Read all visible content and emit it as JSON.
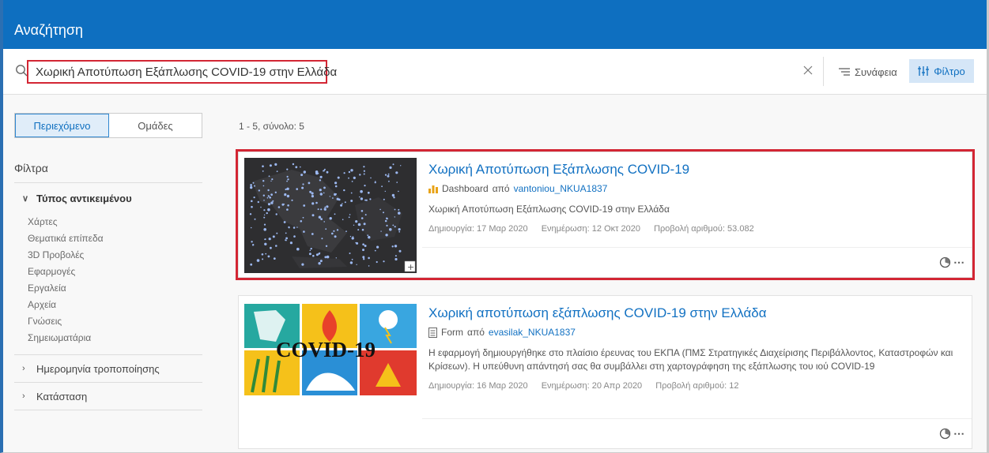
{
  "header": {
    "title": "Αναζήτηση"
  },
  "search": {
    "query": "Χωρική Αποτύπωση Εξάπλωσης COVID-19 στην Ελλάδα"
  },
  "toolbar": {
    "sort_label": "Συνάφεια",
    "filter_label": "Φίλτρο"
  },
  "sidebar": {
    "tabs": [
      "Περιεχόμενο",
      "Ομάδες"
    ],
    "filters_title": "Φίλτρα",
    "item_type": {
      "label": "Τύπος αντικειμένου",
      "options": [
        "Χάρτες",
        "Θεματικά επίπεδα",
        "3D Προβολές",
        "Εφαρμογές",
        "Εργαλεία",
        "Αρχεία",
        "Γνώσεις",
        "Σημειωματάρια"
      ]
    },
    "date_modified_label": "Ημερομηνία τροποποίησης",
    "status_label": "Κατάσταση"
  },
  "results": {
    "count_text": "1 - 5, σύνολο: 5",
    "items": [
      {
        "title": "Χωρική Αποτύπωση Εξάπλωσης COVID-19",
        "type": "Dashboard",
        "by": "από",
        "owner": "vantoniou_NKUA1837",
        "snippet": "Χωρική Αποτύπωση Εξάπλωσης COVID-19 στην Ελλάδα",
        "created": "Δημιουργία: 17 Μαρ 2020",
        "modified": "Ενημέρωση: 12 Οκτ 2020",
        "views": "Προβολή αριθμού: 53.082"
      },
      {
        "title": "Χωρική αποτύπωση εξάπλωσης COVID-19 στην Ελλάδα",
        "type": "Form",
        "by": "από",
        "owner": "evasilak_NKUA1837",
        "snippet": "Η εφαρμογή δημιουργήθηκε στο πλαίσιο έρευνας του ΕΚΠΑ (ΠΜΣ Στρατηγικές Διαχείρισης Περιβάλλοντος, Καταστροφών και Κρίσεων). Η υπεύθυνη απάντησή σας θα συμβάλλει στη χαρτογράφηση της εξάπλωσης του ιού COVID-19",
        "created": "Δημιουργία: 16 Μαρ 2020",
        "modified": "Ενημέρωση: 20 Απρ 2020",
        "views": "Προβολή αριθμού: 12",
        "thumb_text": "COVID-19"
      }
    ]
  },
  "colors": {
    "brand": "#0e6fc0",
    "highlight": "#d32634",
    "link": "#1271c2"
  },
  "icons": [
    "search-icon",
    "close-icon",
    "sort-icon",
    "filter-icon",
    "dashboard-icon",
    "form-icon",
    "view-icon",
    "more-icon",
    "chevron-down-icon",
    "chevron-right-icon"
  ]
}
